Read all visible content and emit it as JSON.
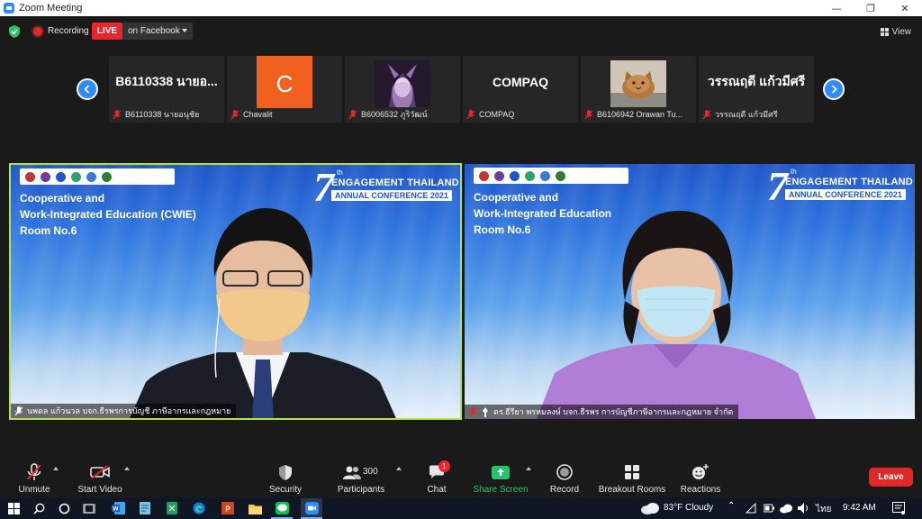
{
  "window": {
    "title": "Zoom Meeting",
    "controls": [
      "—",
      "❐",
      "✕"
    ]
  },
  "status": {
    "recording_label": "Recording",
    "live_label": "LIVE",
    "stream_target": "on Facebook",
    "view_label": "View"
  },
  "thumbnails": [
    {
      "display": "B6110338 นายอ...",
      "label": "B6110338 นายอนุชัย",
      "type": "text"
    },
    {
      "display": "C",
      "label": "Chavalit",
      "type": "avatar-letter",
      "color": "#f2601f"
    },
    {
      "display": "",
      "label": "B6006532 ภูริวัฒน์",
      "type": "avatar-image"
    },
    {
      "display": "COMPAQ",
      "label": "COMPAQ",
      "type": "text"
    },
    {
      "display": "",
      "label": "B6106942 Orawan Tu...",
      "type": "avatar-image"
    },
    {
      "display": "วรรณฤดี แก้วมีศรี",
      "label": "วรรณฤดี แก้วมีศรี",
      "type": "text"
    }
  ],
  "video_tiles": {
    "left": {
      "room_lines": [
        "Cooperative and",
        "Work-Integrated Education (CWIE)",
        "Room No.6"
      ],
      "name": "นพดล แก้วนวล บจก.ธีรพรการบัญชี ภาษีอากรและกฎหมาย",
      "active_speaker_color": "#b9e23d"
    },
    "right": {
      "room_lines": [
        "Cooperative and",
        "Work-Integrated Education",
        "Room No.6"
      ],
      "name": "ดร.ธีรียา พรหมลงษ์ บจก.ธีรพร การบัญชีภาษีอากรและกฎหมาย จำกัด"
    },
    "banner": {
      "number": "7",
      "suffix": "th",
      "line1": "ENGAGEMENT THAILAND",
      "line2": "ANNUAL CONFERENCE 2021"
    }
  },
  "toolbar": {
    "unmute": "Unmute",
    "start_video": "Start Video",
    "security": "Security",
    "participants": "Participants",
    "participants_count": "300",
    "chat": "Chat",
    "chat_badge": "1",
    "share_screen": "Share Screen",
    "record": "Record",
    "breakout_rooms": "Breakout Rooms",
    "reactions": "Reactions",
    "leave": "Leave"
  },
  "taskbar": {
    "weather": "83°F  Cloudy",
    "language": "ไทย",
    "time": "9:42 AM"
  },
  "colors": {
    "zoom_blue": "#2d8cff",
    "live_red": "#e8262c",
    "leave_red": "#e02828",
    "share_green": "#27c26a",
    "active_speaker": "#b9e23d"
  }
}
